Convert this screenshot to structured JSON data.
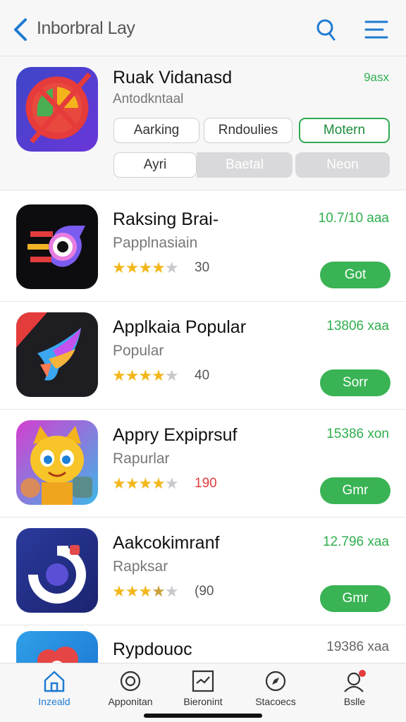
{
  "header": {
    "title": "Inborbral Lay",
    "accent_color": "#1f7bd0",
    "icons": [
      "back-chevron-icon",
      "search-icon",
      "menu-icon"
    ]
  },
  "featured": {
    "title": "Ruak Vidanasd",
    "subtitle": "Antodkntaal",
    "badge": "9asx",
    "chips_row1": [
      "Aarking",
      "Rndoulies",
      "Motern"
    ],
    "chips_row2": [
      "Ayri",
      "Baetal",
      "Neon"
    ]
  },
  "apps": [
    {
      "name": "Raksing Brai-",
      "category": "Papplnasiain",
      "rating": "30",
      "stars": 4,
      "size": "10.7/10 aaa",
      "button": "Got"
    },
    {
      "name": "Applkaia Popular",
      "category": "Popular",
      "rating": "40",
      "stars": 4,
      "size": "13806 xaa",
      "button": "Sorr"
    },
    {
      "name": "Appry Expiprsuf",
      "category": "Rapurlar",
      "rating": "190",
      "stars": 4,
      "size": "15386 xon",
      "button": "Gmr"
    },
    {
      "name": "Aakcokimranf",
      "category": "Rapksar",
      "rating": "(90",
      "stars": 3.5,
      "size": "12.796 xaa",
      "button": "Gmr"
    },
    {
      "name": "Rypdouoc",
      "category": "",
      "rating": "",
      "stars": 0,
      "size": "19386 xaa",
      "button": ""
    }
  ],
  "tabs": [
    {
      "label": "Inzeald",
      "icon": "home-icon",
      "active": true
    },
    {
      "label": "Apponitan",
      "icon": "target-icon",
      "active": false
    },
    {
      "label": "Bieronint",
      "icon": "chart-icon",
      "active": false
    },
    {
      "label": "Stacoecs",
      "icon": "compass-icon",
      "active": false
    },
    {
      "label": "Bslle",
      "icon": "profile-icon",
      "active": false
    }
  ],
  "colors": {
    "green": "#39b354",
    "star": "#f3b71b",
    "text_green": "#2fae4e"
  }
}
